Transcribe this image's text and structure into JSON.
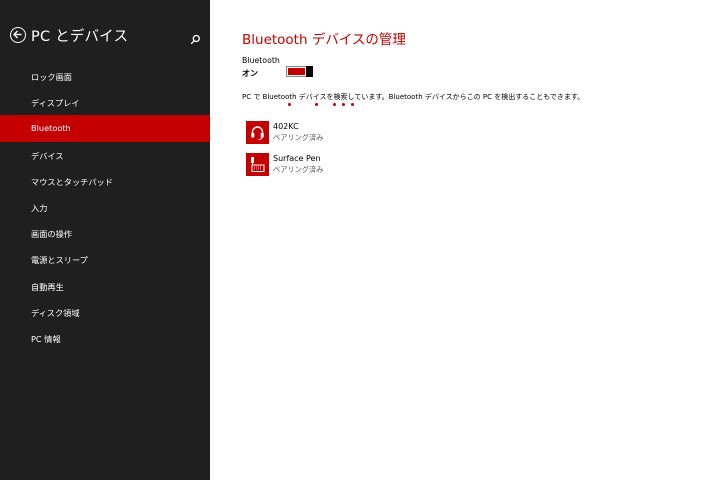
{
  "sidebar": {
    "title": "PC とデバイス",
    "items": [
      {
        "label": "ロック画面"
      },
      {
        "label": "ディスプレイ"
      },
      {
        "label": "Bluetooth"
      },
      {
        "label": "デバイス"
      },
      {
        "label": "マウスとタッチパッド"
      },
      {
        "label": "入力"
      },
      {
        "label": "画面の操作"
      },
      {
        "label": "電源とスリープ"
      },
      {
        "label": "自動再生"
      },
      {
        "label": "ディスク領域"
      },
      {
        "label": "PC 情報"
      }
    ],
    "selected_label": "Bluetooth",
    "icons": {
      "back": "back-arrow-circle-icon",
      "search": "search-icon"
    }
  },
  "main": {
    "title": "Bluetooth デバイスの管理",
    "bluetooth_label": "Bluetooth",
    "bluetooth_state": "オン",
    "toggle_on": true,
    "status": "PC で Bluetooth デバイスを検索しています。Bluetooth デバイスからこの PC を検出することもできます。",
    "devices": [
      {
        "name": "402KC",
        "status": "ペアリング済み",
        "icon": "headset-icon"
      },
      {
        "name": "Surface Pen",
        "status": "ペアリング済み",
        "icon": "keyboard-icon"
      }
    ]
  },
  "colors": {
    "accent": "#c40000",
    "sidebar_bg": "#1f1f1f",
    "background": "#ffffff"
  }
}
